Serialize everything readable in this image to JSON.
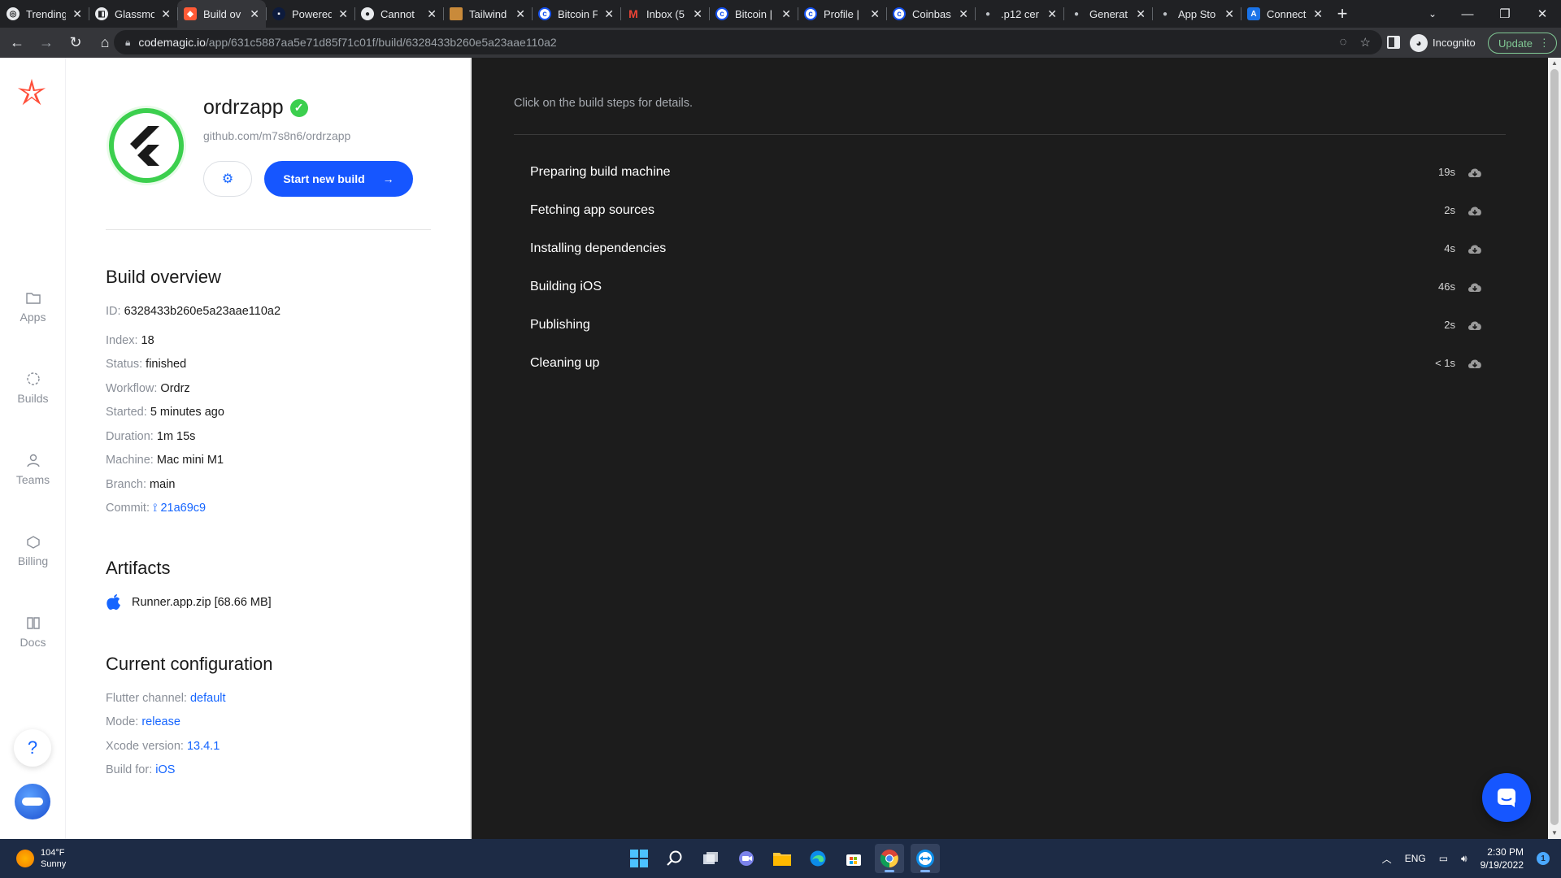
{
  "browser": {
    "tabs": [
      {
        "title": "Trending",
        "icon": "trending-icon"
      },
      {
        "title": "Glassmo",
        "icon": "glassmorphism-icon"
      },
      {
        "title": "Build ov",
        "icon": "codemagic-icon",
        "active": true
      },
      {
        "title": "Powered",
        "icon": "powered-icon"
      },
      {
        "title": "Cannot",
        "icon": "github-icon"
      },
      {
        "title": "Tailwind",
        "icon": "tailwind-icon"
      },
      {
        "title": "Bitcoin F",
        "icon": "coinbase-icon"
      },
      {
        "title": "Inbox (5",
        "icon": "gmail-icon"
      },
      {
        "title": "Bitcoin |",
        "icon": "coinbase-icon"
      },
      {
        "title": "Profile |",
        "icon": "coinbase-icon"
      },
      {
        "title": "Coinbas",
        "icon": "coinbase-icon"
      },
      {
        "title": ".p12 cer",
        "icon": "apple-icon"
      },
      {
        "title": "Generat",
        "icon": "apple-icon"
      },
      {
        "title": "App Sto",
        "icon": "apple-icon"
      },
      {
        "title": "Connect",
        "icon": "app-store-connect-icon"
      }
    ],
    "url_host": "codemagic.io",
    "url_path": "/app/631c5887aa5e71d85f71c01f/build/6328433b260e5a23aae110a2",
    "profile_label": "Incognito",
    "update_label": "Update"
  },
  "nav": {
    "items": [
      {
        "label": "Apps",
        "icon": "folder-icon"
      },
      {
        "label": "Builds",
        "icon": "builds-icon"
      },
      {
        "label": "Teams",
        "icon": "user-icon"
      },
      {
        "label": "Billing",
        "icon": "billing-icon"
      },
      {
        "label": "Docs",
        "icon": "book-icon"
      }
    ],
    "help_label": "?"
  },
  "app": {
    "name": "ordrzapp",
    "repo": "github.com/m7s8n6/ordrzapp",
    "start_build_label": "Start new build",
    "accent": "#1656ff",
    "verified_color": "#3ccf4e"
  },
  "overview": {
    "title": "Build overview",
    "id_label": "ID:",
    "id": "6328433b260e5a23aae110a2",
    "index_label": "Index:",
    "index": "18",
    "status_label": "Status:",
    "status": "finished",
    "workflow_label": "Workflow:",
    "workflow": "Ordrz",
    "started_label": "Started:",
    "started": "5 minutes ago",
    "duration_label": "Duration:",
    "duration": "1m 15s",
    "machine_label": "Machine:",
    "machine": "Mac mini M1",
    "branch_label": "Branch:",
    "branch": "main",
    "commit_label": "Commit:",
    "commit": "21a69c9"
  },
  "artifacts": {
    "title": "Artifacts",
    "file": "Runner.app.zip [68.66 MB]"
  },
  "config": {
    "title": "Current configuration",
    "flutter_label": "Flutter channel:",
    "flutter": "default",
    "mode_label": "Mode:",
    "mode": "release",
    "xcode_label": "Xcode version:",
    "xcode": "13.4.1",
    "build_for_label": "Build for:",
    "build_for": "iOS"
  },
  "steps": {
    "hint": "Click on the build steps for details.",
    "items": [
      {
        "name": "Preparing build machine",
        "duration": "19s"
      },
      {
        "name": "Fetching app sources",
        "duration": "2s"
      },
      {
        "name": "Installing dependencies",
        "duration": "4s"
      },
      {
        "name": "Building iOS",
        "duration": "46s"
      },
      {
        "name": "Publishing",
        "duration": "2s"
      },
      {
        "name": "Cleaning up",
        "duration": "< 1s"
      }
    ]
  },
  "taskbar": {
    "temp": "104°F",
    "weather": "Sunny",
    "lang": "ENG",
    "time": "2:30 PM",
    "date": "9/19/2022",
    "notifications": "1"
  }
}
